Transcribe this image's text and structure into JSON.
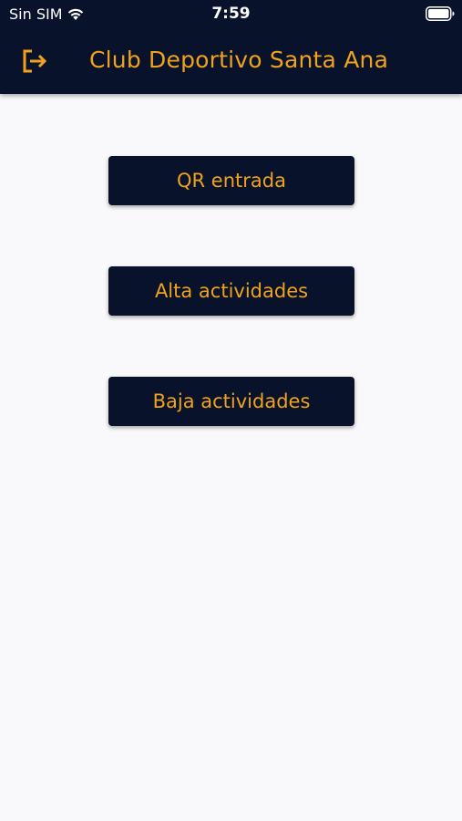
{
  "status_bar": {
    "carrier": "Sin SIM",
    "time": "7:59"
  },
  "header": {
    "title": "Club Deportivo Santa Ana",
    "logout_icon": "logout-icon"
  },
  "menu": {
    "buttons": [
      {
        "label": "QR entrada"
      },
      {
        "label": "Alta actividades"
      },
      {
        "label": "Baja actividades"
      }
    ]
  },
  "colors": {
    "primary": "#08132b",
    "accent": "#f0a21c",
    "background": "#f9f9fb"
  }
}
